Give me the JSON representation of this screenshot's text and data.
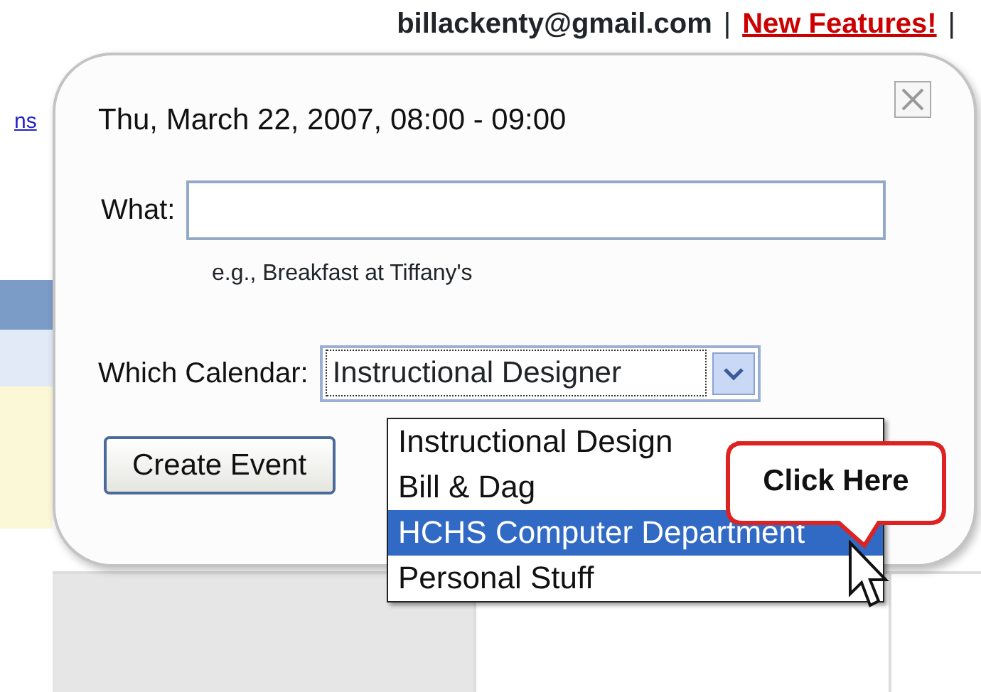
{
  "header": {
    "account": "billackenty@gmail.com",
    "separator_1": "|",
    "link": "New Features!",
    "separator_2": "|"
  },
  "side_link": "ns",
  "dialog": {
    "title": "Thu, March 22, 2007, 08:00 - 09:00",
    "what_label": "What:",
    "hint": "e.g., Breakfast at Tiffany's",
    "calendar_label": "Which Calendar:",
    "calendar_value": "Instructional Designer",
    "expanded": true,
    "options": [
      {
        "label": "Instructional Design",
        "selected": false
      },
      {
        "label": "Bill & Dag",
        "selected": false
      },
      {
        "label": "HCHS Computer Department",
        "selected": true
      },
      {
        "label": "Personal Stuff",
        "selected": false
      }
    ],
    "button": "Create Event"
  },
  "callout": {
    "text": "Click Here"
  }
}
